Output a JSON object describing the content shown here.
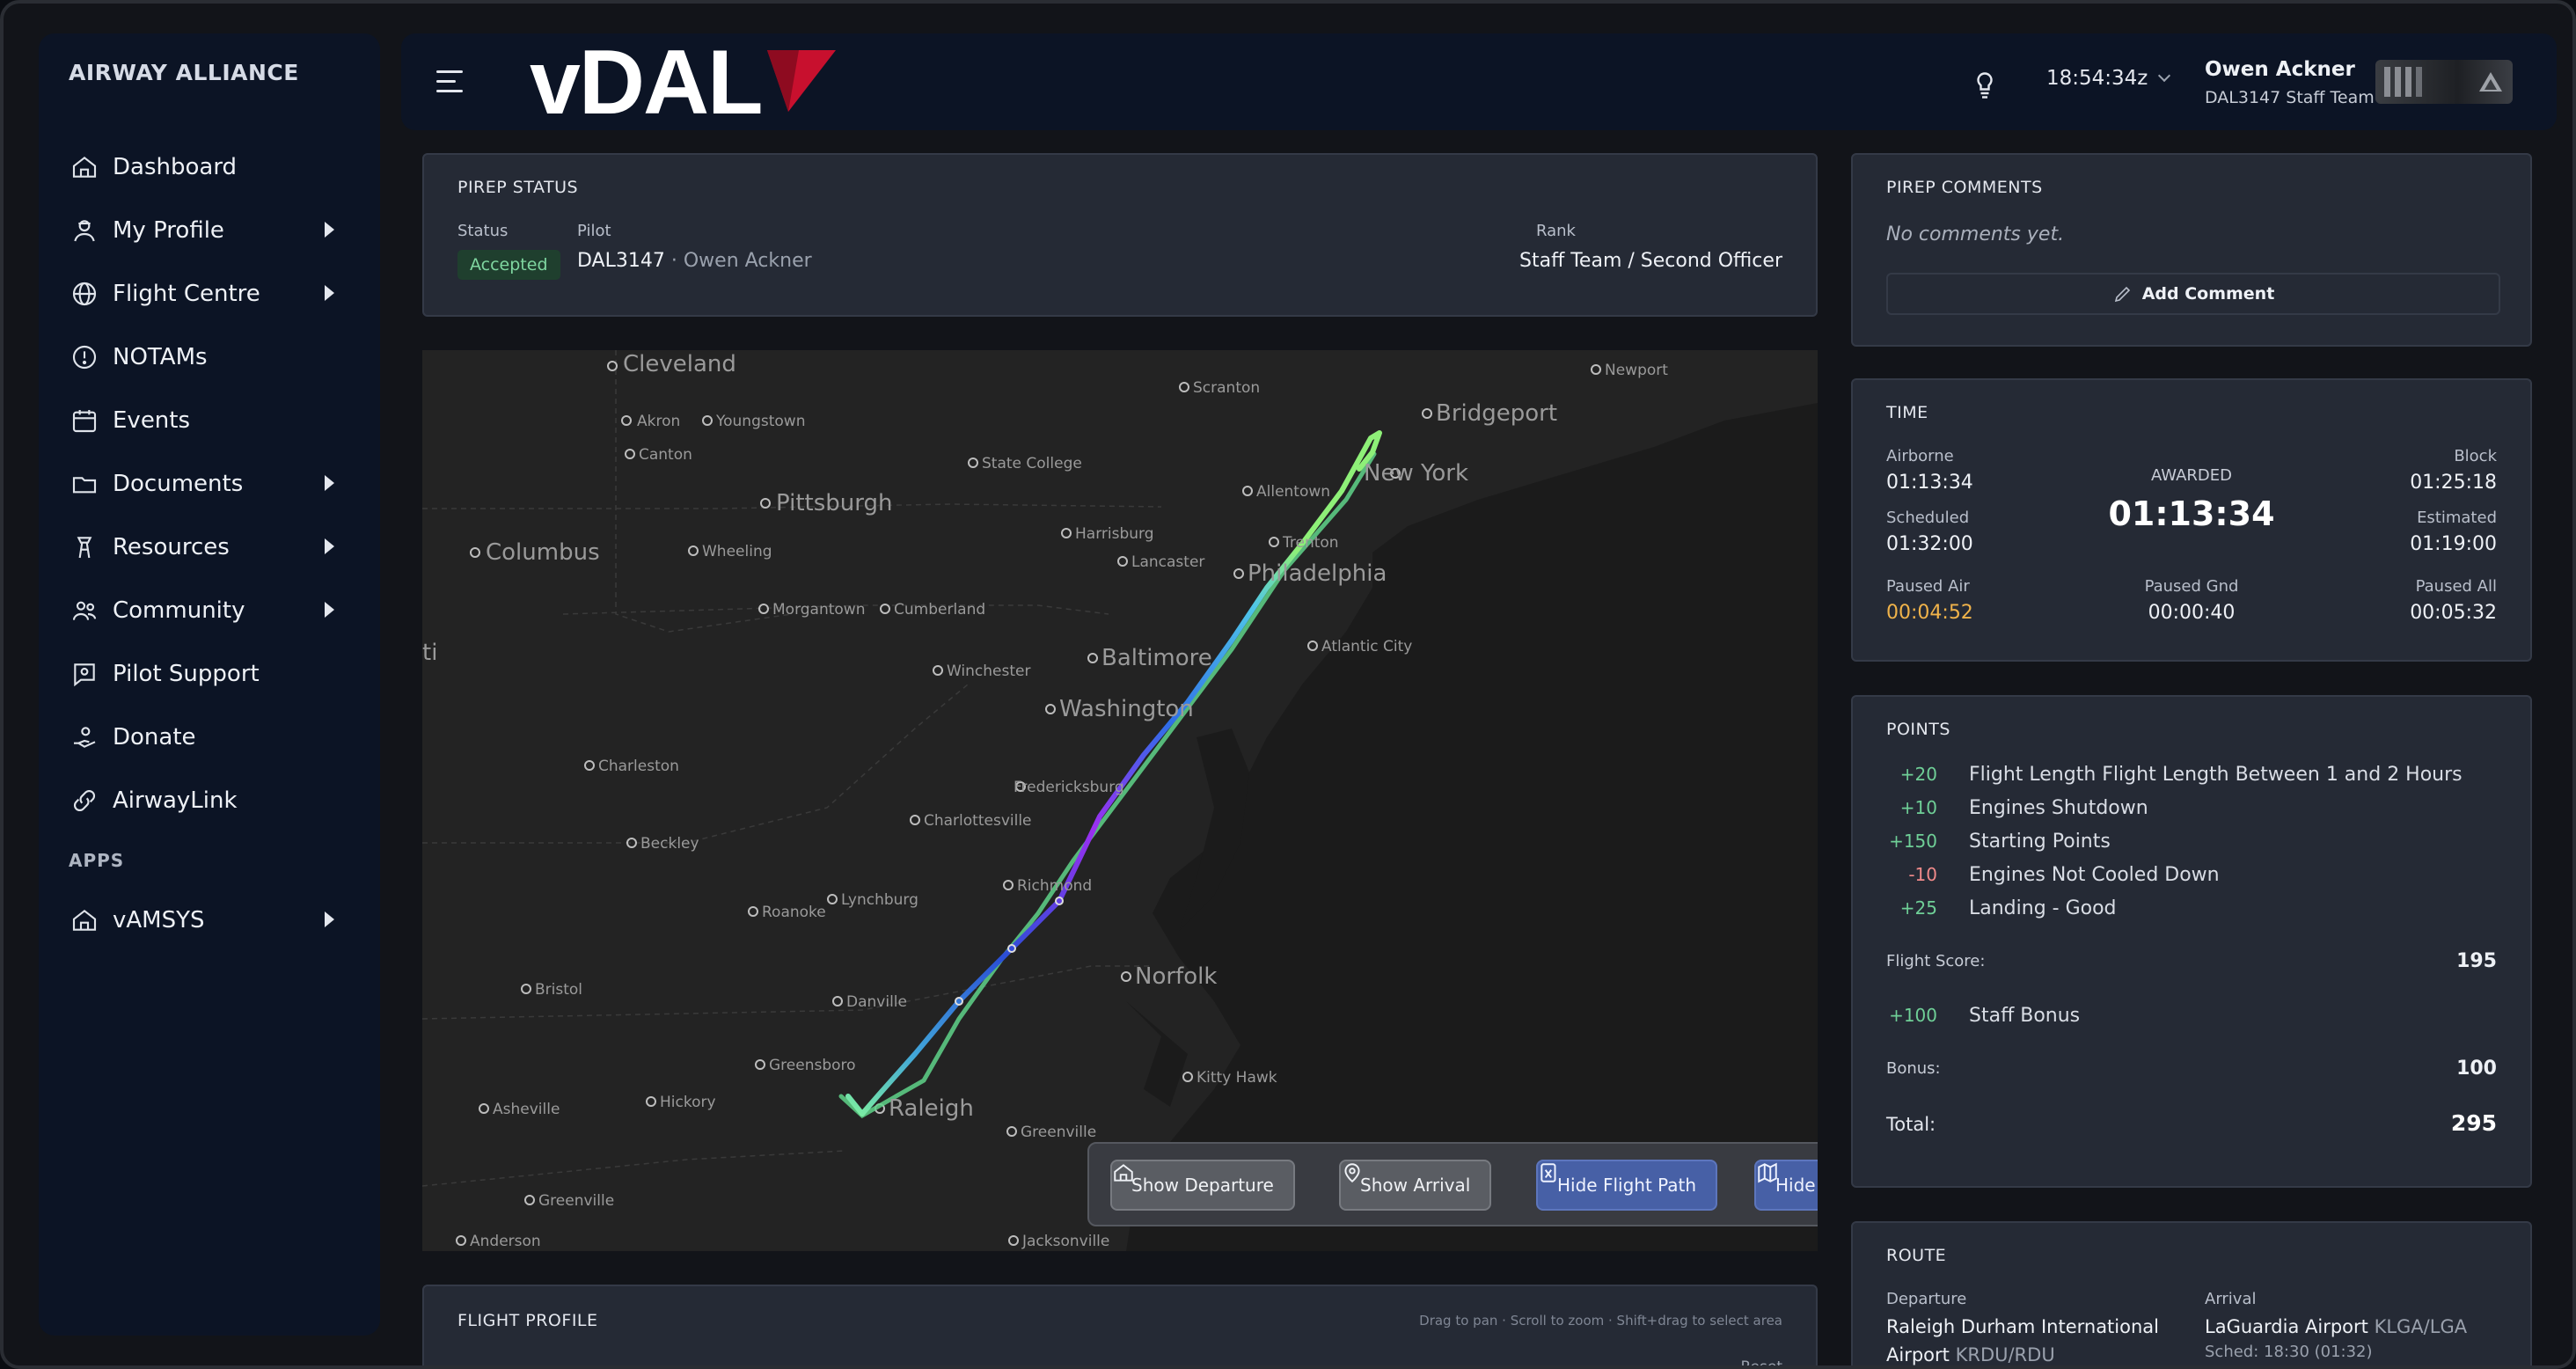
{
  "sidebar": {
    "brand": "AIRWAY ALLIANCE",
    "items": [
      {
        "label": "Dashboard",
        "icon": "home-icon",
        "submenu": false
      },
      {
        "label": "My Profile",
        "icon": "pilot-icon",
        "submenu": true
      },
      {
        "label": "Flight Centre",
        "icon": "globe-icon",
        "submenu": true
      },
      {
        "label": "NOTAMs",
        "icon": "alert-circle-icon",
        "submenu": false
      },
      {
        "label": "Events",
        "icon": "calendar-icon",
        "submenu": false
      },
      {
        "label": "Documents",
        "icon": "folder-icon",
        "submenu": true
      },
      {
        "label": "Resources",
        "icon": "tower-icon",
        "submenu": true
      },
      {
        "label": "Community",
        "icon": "users-icon",
        "submenu": true
      },
      {
        "label": "Pilot Support",
        "icon": "support-icon",
        "submenu": false
      },
      {
        "label": "Donate",
        "icon": "donate-icon",
        "submenu": false
      },
      {
        "label": "AirwayLink",
        "icon": "link-icon",
        "submenu": false
      }
    ],
    "apps_label": "APPS",
    "apps": [
      {
        "label": "vAMSYS",
        "icon": "home-icon",
        "submenu": true
      }
    ]
  },
  "header": {
    "logo_text": "vDAL",
    "time": "18:54:34z",
    "user_name": "Owen Ackner",
    "user_team": "DAL3147 Staff Team",
    "accent": "#c8102e"
  },
  "pirep_status": {
    "title": "PIREP STATUS",
    "status_label": "Status",
    "status": "Accepted",
    "pilot_label": "Pilot",
    "pilot_id": "DAL3147",
    "pilot_name": "· Owen Ackner",
    "rank_label": "Rank",
    "rank": "Staff Team / Second Officer"
  },
  "map": {
    "labels": [
      "Cleveland",
      "Akron",
      "Youngstown",
      "Canton",
      "Pittsburgh",
      "Columbus",
      "Wheeling",
      "State College",
      "Scranton",
      "Allentown",
      "Bridgeport",
      "New York",
      "Newport",
      "Harrisburg",
      "Lancaster",
      "Trenton",
      "Philadelphia",
      "Morgantown",
      "Cumberland",
      "Baltimore",
      "Atlantic City",
      "Winchester",
      "Washington",
      "Charleston",
      "Fredericksburg",
      "Charlottesville",
      "Beckley",
      "Richmond",
      "Lynchburg",
      "Roanoke",
      "Bristol",
      "Danville",
      "Norfolk",
      "Greensboro",
      "Raleigh",
      "Kitty Hawk",
      "Asheville",
      "Hickory",
      "Greenville",
      "Greenville",
      "Anderson",
      "Jacksonville",
      "ti"
    ],
    "buttons": {
      "show_departure": "Show Departure",
      "show_arrival": "Show Arrival",
      "hide_flight_path": "Hide Flight Path",
      "hide_filed_route": "Hide Filed Route"
    }
  },
  "flight_profile": {
    "title": "FLIGHT PROFILE",
    "hint": "Drag to pan · Scroll to zoom · Shift+drag to select area",
    "reset": "Reset"
  },
  "comments": {
    "title": "PIREP COMMENTS",
    "empty": "No comments yet.",
    "add": "Add Comment"
  },
  "time": {
    "title": "TIME",
    "airborne_label": "Airborne",
    "airborne": "01:13:34",
    "awarded_label": "AWARDED",
    "awarded": "01:13:34",
    "block_label": "Block",
    "block": "01:25:18",
    "scheduled_label": "Scheduled",
    "scheduled": "01:32:00",
    "estimated_label": "Estimated",
    "estimated": "01:19:00",
    "paused_air_label": "Paused Air",
    "paused_air": "00:04:52",
    "paused_gnd_label": "Paused Gnd",
    "paused_gnd": "00:00:40",
    "paused_all_label": "Paused All",
    "paused_all": "00:05:32",
    "warn_color": "#f0b34a"
  },
  "points": {
    "title": "POINTS",
    "items": [
      {
        "value": "+20",
        "desc": "Flight Length Flight Length Between 1 and 2 Hours"
      },
      {
        "value": "+10",
        "desc": "Engines Shutdown"
      },
      {
        "value": "+150",
        "desc": "Starting Points"
      },
      {
        "value": "-10",
        "desc": "Engines Not Cooled Down"
      },
      {
        "value": "+25",
        "desc": "Landing - Good"
      }
    ],
    "score_label": "Flight Score:",
    "score": "195",
    "bonus_items": [
      {
        "value": "+100",
        "desc": "Staff Bonus"
      }
    ],
    "bonus_label": "Bonus:",
    "bonus": "100",
    "total_label": "Total:",
    "total": "295"
  },
  "route": {
    "title": "ROUTE",
    "departure_label": "Departure",
    "departure_name_1": "Raleigh Durham International",
    "departure_name_2": "Airport",
    "departure_code": "KRDU/RDU",
    "arrival_label": "Arrival",
    "arrival_name": "LaGuardia Airport",
    "arrival_code": "KLGA/LGA",
    "arrival_sched": "Sched: 18:30 (01:32)"
  }
}
